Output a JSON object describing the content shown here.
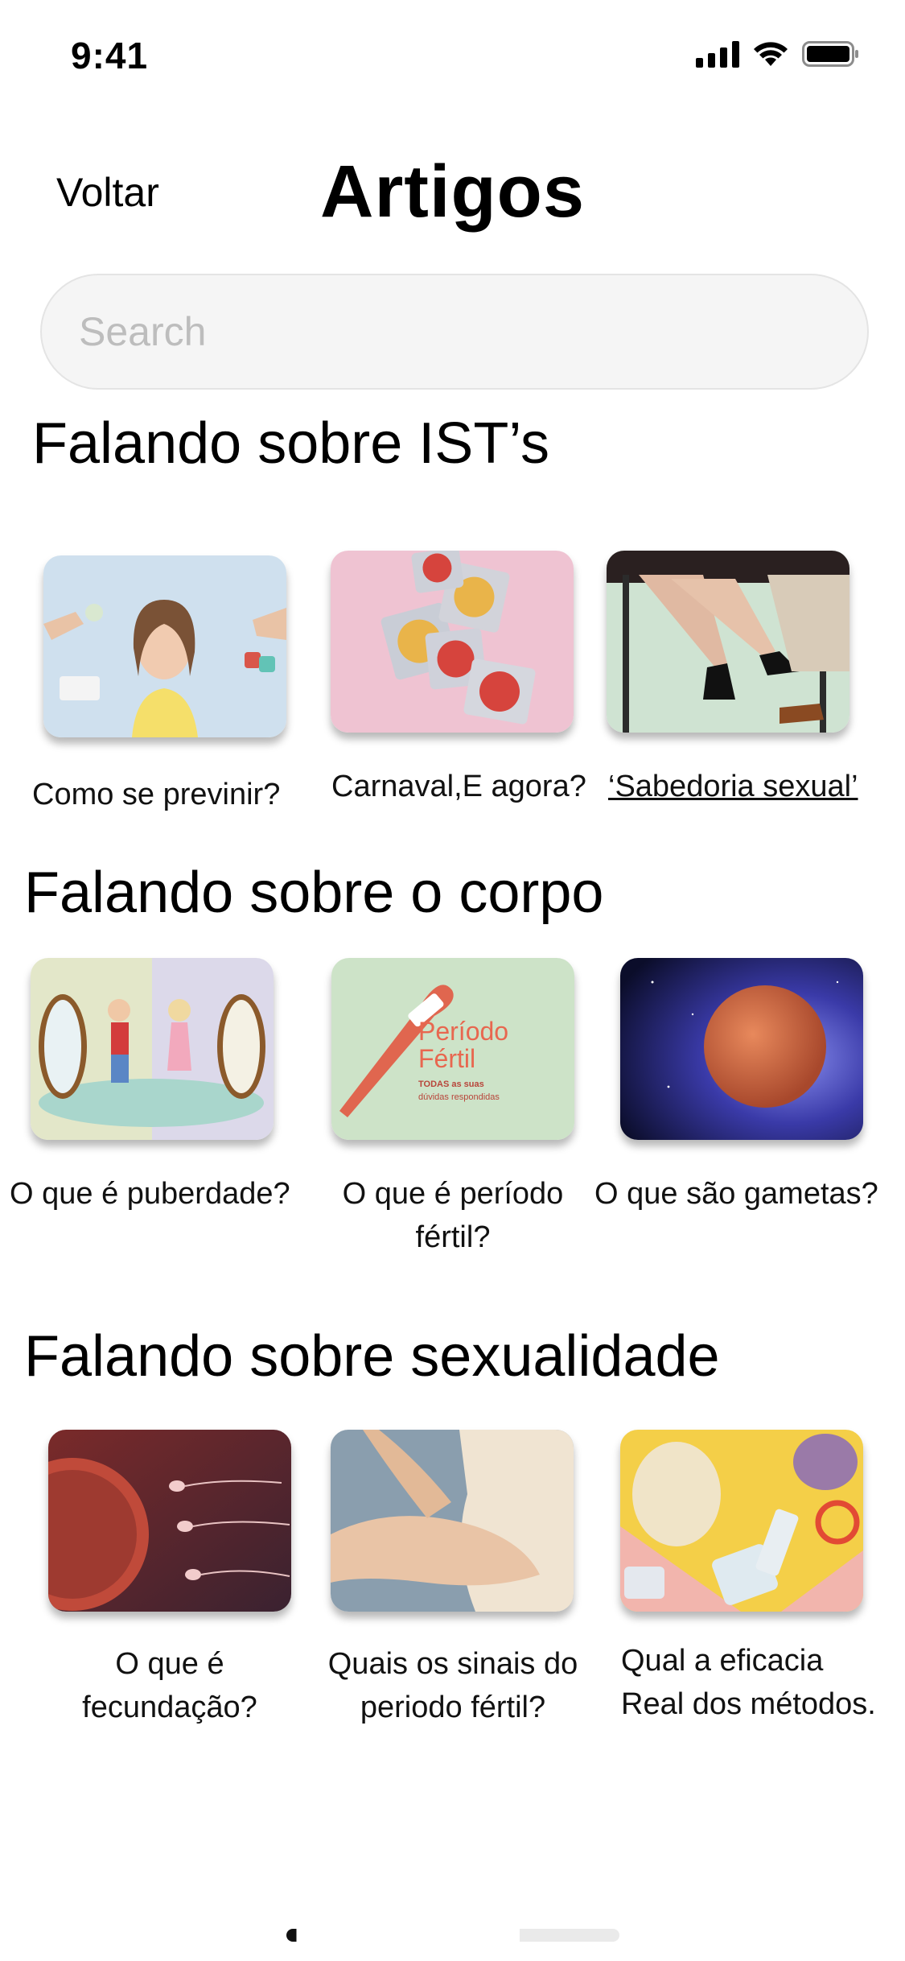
{
  "status_bar": {
    "time": "9:41"
  },
  "header": {
    "back_label": "Voltar",
    "title": "Artigos"
  },
  "search": {
    "placeholder": "Search"
  },
  "sections": [
    {
      "title": "Falando sobre IST’s",
      "cards": [
        {
          "caption": "Como se previnir?",
          "image": "woman-thinking-contraceptives-image"
        },
        {
          "caption": "Carnaval,E agora?",
          "image": "condoms-image"
        },
        {
          "caption": "‘Sabedoria sexual’",
          "image": "legs-heels-image"
        }
      ]
    },
    {
      "title": "Falando sobre o corpo",
      "cards": [
        {
          "caption_lines": [
            "O que é puberdade?"
          ],
          "image": "puberty-mirror-image"
        },
        {
          "caption_lines": [
            "O que é período",
            "fértil?"
          ],
          "image": "fertile-period-thermometer-image",
          "image_text": {
            "line1": "Período",
            "line2": "Fértil",
            "line3": "TODAS as suas",
            "line4": "dúvidas respondidas"
          }
        },
        {
          "caption_lines": [
            "O que são gametas?"
          ],
          "image": "ovum-image"
        }
      ]
    },
    {
      "title": "Falando sobre sexualidade",
      "cards": [
        {
          "caption_lines": [
            "O que é",
            "fecundação?"
          ],
          "image": "fertilization-image"
        },
        {
          "caption_lines": [
            "Quais os sinais do",
            "periodo fértil?"
          ],
          "image": "woman-body-image"
        },
        {
          "caption_lines": [
            "Qual a eficacia",
            "Real dos métodos."
          ],
          "image": "contraceptive-methods-image"
        }
      ]
    }
  ],
  "colors": {
    "search_bg": "#f5f5f5",
    "placeholder": "#bdbdbd",
    "text": "#000000"
  }
}
